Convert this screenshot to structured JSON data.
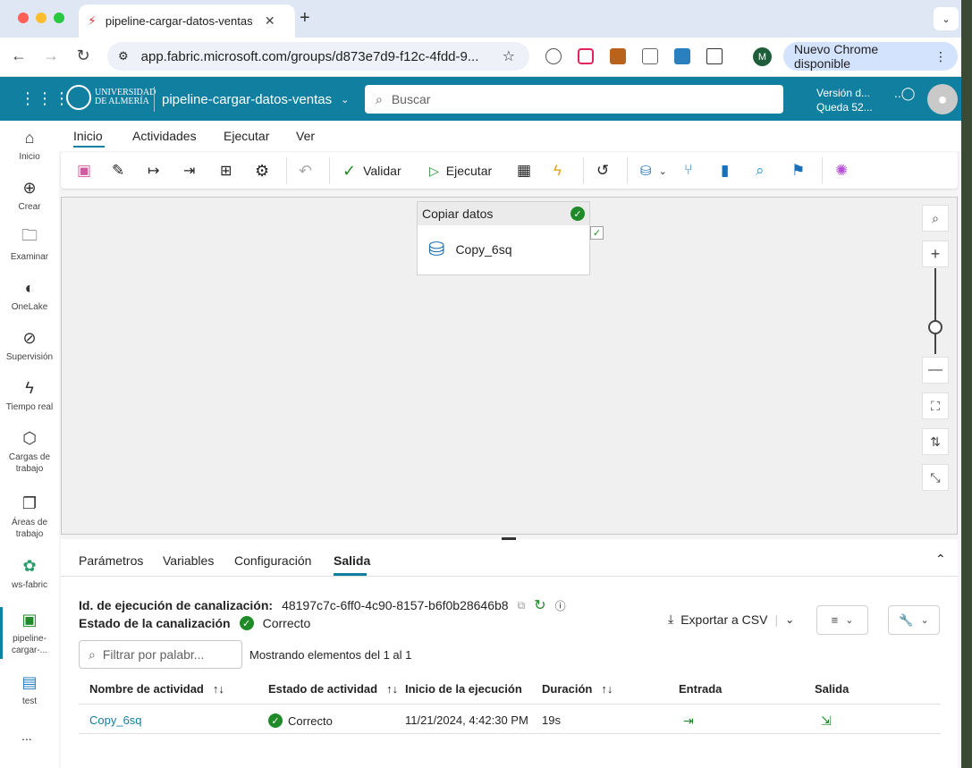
{
  "browser": {
    "tab_title": "pipeline-cargar-datos-ventas",
    "url": "app.fabric.microsoft.com/groups/d873e7d9-f12c-4fdd-9...",
    "new_chrome_label": "Nuevo Chrome disponible",
    "profile_initial": "M"
  },
  "header": {
    "logo_line1": "UNIVERSIDAD",
    "logo_line2": "DE ALMERÍA",
    "pipeline_name": "pipeline-cargar-datos-ventas",
    "search_placeholder": "Buscar",
    "trial_line1": "Versión d...",
    "trial_line2": "Queda 52..."
  },
  "leftnav": {
    "items": [
      {
        "label": "Inicio",
        "icon": "home-icon"
      },
      {
        "label": "Crear",
        "icon": "plus-circle-icon"
      },
      {
        "label": "Examinar",
        "icon": "folder-icon"
      },
      {
        "label": "OneLake",
        "icon": "onelake-icon"
      },
      {
        "label": "Supervisión",
        "icon": "monitor-icon"
      },
      {
        "label": "Tiempo real",
        "icon": "lightning-icon"
      },
      {
        "label": "Cargas de trabajo",
        "icon": "workloads-icon"
      },
      {
        "label": "Áreas de trabajo",
        "icon": "workspaces-icon"
      },
      {
        "label": "ws-fabric",
        "icon": "workspace-icon"
      },
      {
        "label": "pipeline-cargar-...",
        "icon": "pipeline-icon"
      },
      {
        "label": "test",
        "icon": "test-icon"
      }
    ],
    "more": "..."
  },
  "menu": {
    "tabs": [
      "Inicio",
      "Actividades",
      "Ejecutar",
      "Ver"
    ]
  },
  "toolbar": {
    "validate_label": "Validar",
    "run_label": "Ejecutar"
  },
  "canvas": {
    "activity_type": "Copiar datos",
    "activity_name": "Copy_6sq"
  },
  "panel": {
    "tabs": [
      "Parámetros",
      "Variables",
      "Configuración",
      "Salida"
    ],
    "run_id_label": "Id. de ejecución de canalización:",
    "run_id_value": "48197c7c-6ff0-4c90-8157-b6f0b28646b8",
    "status_label": "Estado de la canalización",
    "status_value": "Correcto",
    "export_label": "Exportar a CSV",
    "filter_placeholder": "Filtrar por palabr...",
    "showing_text": "Mostrando elementos del 1 al 1",
    "columns": [
      "Nombre de actividad",
      "Estado de actividad",
      "Inicio de la ejecución",
      "Duración",
      "Entrada",
      "Salida"
    ],
    "rows": [
      {
        "name": "Copy_6sq",
        "status": "Correcto",
        "start": "11/21/2024, 4:42:30 PM",
        "duration": "19s"
      }
    ]
  },
  "colors": {
    "brand": "#117fa0",
    "success": "#1f8a28"
  }
}
